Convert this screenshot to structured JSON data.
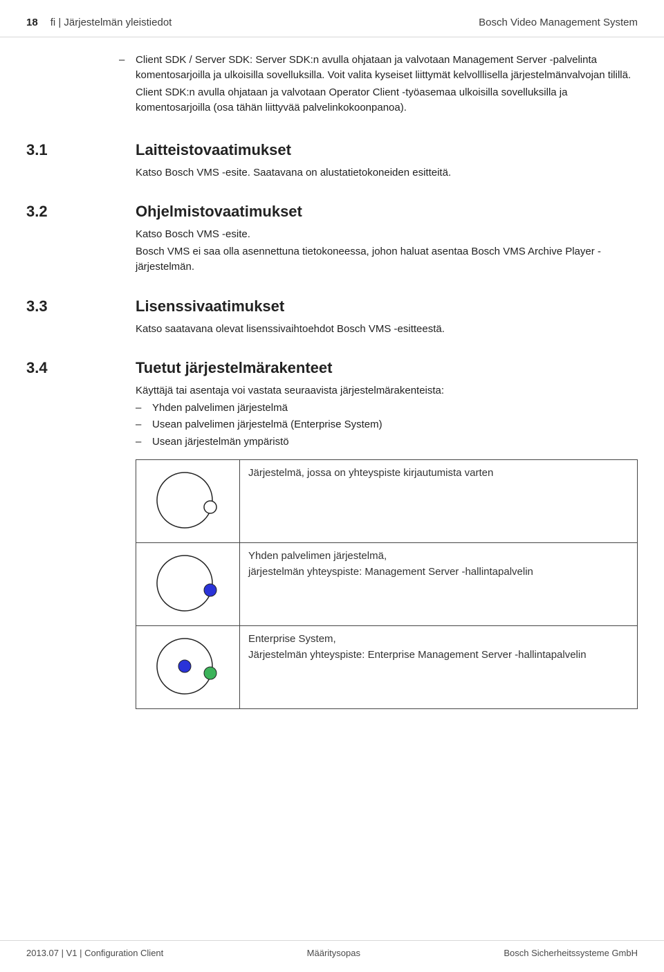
{
  "header": {
    "page_num": "18",
    "left_title": "fi | Järjestelmän yleistiedot",
    "right_title": "Bosch Video Management System"
  },
  "intro": {
    "bullet_text": "Client SDK / Server SDK: Server SDK:n avulla ohjataan ja valvotaan Management Server -palvelinta komentosarjoilla ja ulkoisilla sovelluksilla. Voit valita kyseiset liittymät kelvolllisella järjestelmänvalvojan tilillä.",
    "followup": "Client SDK:n avulla ohjataan ja valvotaan Operator Client -työasemaa ulkoisilla sovelluksilla ja komentosarjoilla (osa tähän liittyvää palvelinkokoonpanoa)."
  },
  "sections": {
    "s31": {
      "num": "3.1",
      "title": "Laitteistovaatimukset",
      "body": "Katso Bosch VMS -esite. Saatavana on alustatietokoneiden esitteitä."
    },
    "s32": {
      "num": "3.2",
      "title": "Ohjelmistovaatimukset",
      "body1": "Katso Bosch VMS -esite.",
      "body2": "Bosch VMS ei saa olla asennettuna tietokoneessa, johon haluat asentaa Bosch VMS Archive Player -järjestelmän."
    },
    "s33": {
      "num": "3.3",
      "title": "Lisenssivaatimukset",
      "body": "Katso saatavana olevat lisenssivaihtoehdot Bosch VMS -esitteestä."
    },
    "s34": {
      "num": "3.4",
      "title": "Tuetut järjestelmärakenteet",
      "intro": "Käyttäjä tai asentaja voi vastata seuraavista järjestelmärakenteista:",
      "items": {
        "i1": "Yhden palvelimen järjestelmä",
        "i2": "Usean palvelimen järjestelmä (Enterprise System)",
        "i3": "Usean järjestelmän ympäristö"
      },
      "table": {
        "row1": "Järjestelmä, jossa on yhteyspiste kirjautumista varten",
        "row2a": "Yhden palvelimen järjestelmä,",
        "row2b": "järjestelmän yhteyspiste: Management Server -hallintapalvelin",
        "row3a": "Enterprise System,",
        "row3b": "Järjestelmän yhteyspiste: Enterprise Management Server -hallintapalvelin"
      }
    }
  },
  "footer": {
    "left": "2013.07 | V1 | Configuration Client",
    "center": "Määritysopas",
    "right": "Bosch Sicherheitssysteme GmbH"
  }
}
